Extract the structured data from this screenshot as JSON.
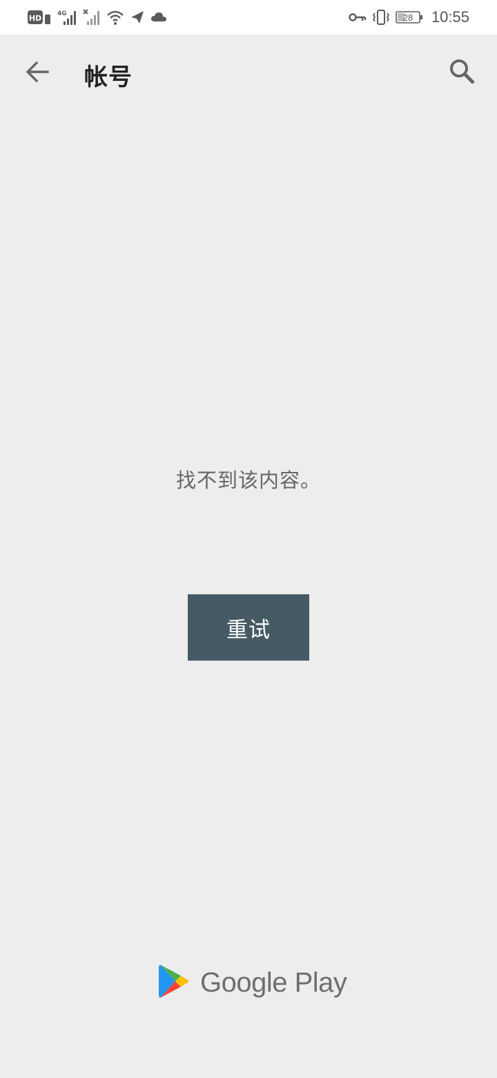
{
  "status_bar": {
    "network_badge": "HD",
    "network_type": "4G",
    "battery_level": "28",
    "time": "10:55",
    "icons": [
      "hd-icon",
      "signal-4g-icon",
      "signal-no-service-icon",
      "wifi-icon",
      "send-icon",
      "cloud-icon",
      "key-icon",
      "vibrate-icon",
      "battery-icon"
    ]
  },
  "app_bar": {
    "title": "帐号",
    "back_icon": "arrow-back-icon",
    "search_icon": "search-icon"
  },
  "main": {
    "message": "找不到该内容。",
    "retry_label": "重试"
  },
  "footer": {
    "brand_name": "Google Play"
  },
  "colors": {
    "background": "#ededed",
    "status_bar": "#ffffff",
    "button": "#455a64",
    "button_text": "#ffffff",
    "message_text": "#666666",
    "title_text": "#222222"
  }
}
